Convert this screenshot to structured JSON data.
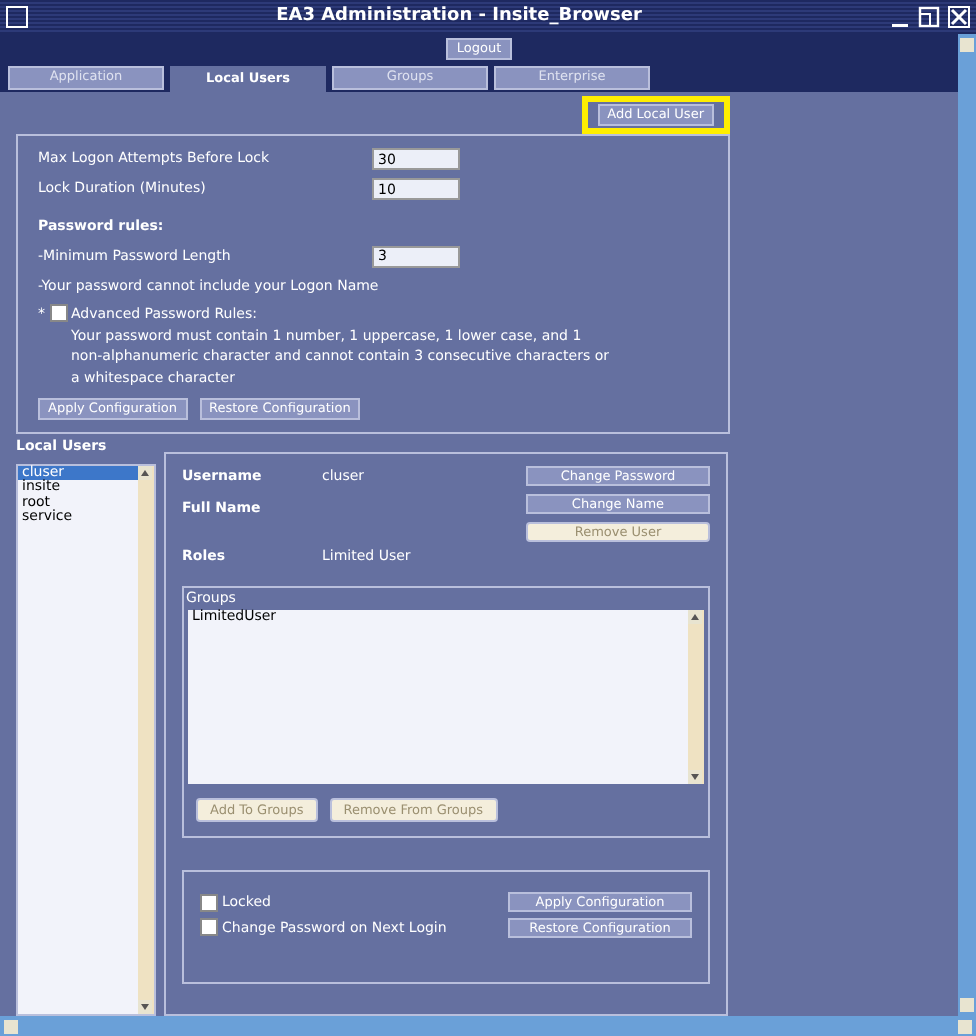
{
  "window": {
    "title": "EA3 Administration - Insite_Browser"
  },
  "logout_button": "Logout",
  "tabs": [
    {
      "label": "Application",
      "selected": false
    },
    {
      "label": "Local Users",
      "selected": true
    },
    {
      "label": "Groups",
      "selected": false
    },
    {
      "label": "Enterprise",
      "selected": false
    }
  ],
  "add_local_user_button": {
    "label": "Add Local User",
    "highlighted": true
  },
  "lockout_settings": {
    "fields": [
      {
        "label": "Max Logon Attempts Before Lock",
        "value": "30"
      },
      {
        "label": "Lock Duration (Minutes)",
        "value": "10"
      }
    ],
    "password_rules": {
      "heading": "Password rules:",
      "min_length": {
        "label": "-Minimum Password Length",
        "value": "3"
      },
      "note": "-Your password cannot include your Logon Name",
      "advanced": {
        "marker": "*",
        "label": "Advanced Password Rules:",
        "checked": false,
        "description": "Your password must contain 1 number, 1 uppercase, 1 lower case, and 1 non-alphanumeric character and cannot contain 3 consecutive characters or a whitespace character"
      }
    },
    "buttons": [
      "Apply Configuration",
      "Restore Configuration"
    ]
  },
  "local_users": {
    "heading": "Local Users",
    "users": [
      {
        "name": "cluser",
        "selected": true
      },
      {
        "name": "insite",
        "selected": false
      },
      {
        "name": "root",
        "selected": false
      },
      {
        "name": "service",
        "selected": false
      }
    ]
  },
  "user_details": {
    "fields": [
      {
        "label": "Username",
        "value": "cluser"
      },
      {
        "label": "Full Name"
      },
      {
        "label": "Roles",
        "value": "Limited User"
      }
    ],
    "actions": [
      {
        "label": "Change Password",
        "disabled": false
      },
      {
        "label": "Change Name",
        "disabled": false
      },
      {
        "label": "Remove User",
        "disabled": true
      }
    ],
    "groups": {
      "legend": "Groups",
      "items": [
        "LimitedUser"
      ]
    },
    "group_buttons": [
      {
        "label": "Add To Groups",
        "disabled": true
      },
      {
        "label": "Remove From Groups",
        "disabled": true
      }
    ],
    "options": [
      {
        "label": "Locked",
        "checked": false
      },
      {
        "label": "Change Password on Next Login",
        "checked": false
      }
    ],
    "buttons": [
      "Apply Configuration",
      "Restore Configuration"
    ]
  }
}
